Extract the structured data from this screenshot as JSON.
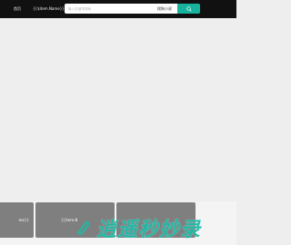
{
  "header": {
    "nav_home": "首页",
    "nav_tag": "{{$item.Name}}",
    "search": {
      "placeholder": "输入关键词搜索",
      "engine": "搜狗小说"
    },
    "accent_color": "#17b39c",
    "search_icon": "search-icon"
  },
  "cards": [
    {
      "label": "me}}"
    },
    {
      "label": "{{item.N"
    },
    {
      "label": ""
    }
  ],
  "watermark": {
    "text": "逍遥秒妙录",
    "icon": "paperclip-logo-icon",
    "color": "#1fb9a6"
  }
}
